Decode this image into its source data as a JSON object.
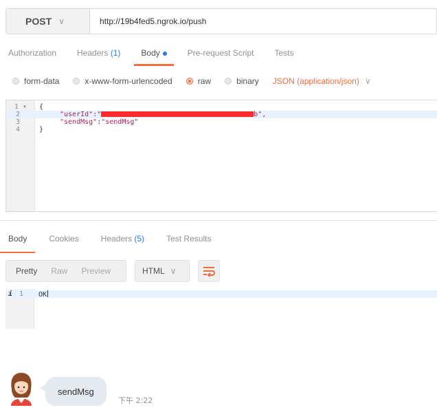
{
  "request": {
    "method": "POST",
    "url": "http://19b4fed5.ngrok.io/push"
  },
  "request_tabs": [
    {
      "label": "Authorization",
      "count": ""
    },
    {
      "label": "Headers ",
      "count": "(1)"
    },
    {
      "label": "Body",
      "count": ""
    },
    {
      "label": "Pre-request Script",
      "count": ""
    },
    {
      "label": "Tests",
      "count": ""
    }
  ],
  "body_types": [
    "form-data",
    "x-www-form-urlencoded",
    "raw",
    "binary"
  ],
  "content_type": "JSON (application/json)",
  "editor": {
    "line_numbers": [
      "1",
      "2",
      "3",
      "4"
    ],
    "line1": "{",
    "userId_key": "\"userId\"",
    "userId_open": ":\"",
    "userId_tail": "b\",",
    "sendMsg_key": "\"sendMsg\"",
    "sendMsg_sep": ":",
    "sendMsg_value": "\"sendMsg\"",
    "line4": "}"
  },
  "response_tabs": [
    {
      "label": "Body",
      "count": ""
    },
    {
      "label": "Cookies",
      "count": ""
    },
    {
      "label": "Headers ",
      "count": "(5)"
    },
    {
      "label": "Test Results",
      "count": ""
    }
  ],
  "view_modes": [
    "Pretty",
    "Raw",
    "Preview"
  ],
  "format": "HTML",
  "output": {
    "info": "i",
    "line_number": "1",
    "text": "OK"
  },
  "chat": {
    "message": "sendMsg",
    "time": "下午 2:22"
  },
  "colors": {
    "accent": "#f26b3a",
    "link_blue": "#2b78e4",
    "redaction": "#ff2a2a"
  }
}
